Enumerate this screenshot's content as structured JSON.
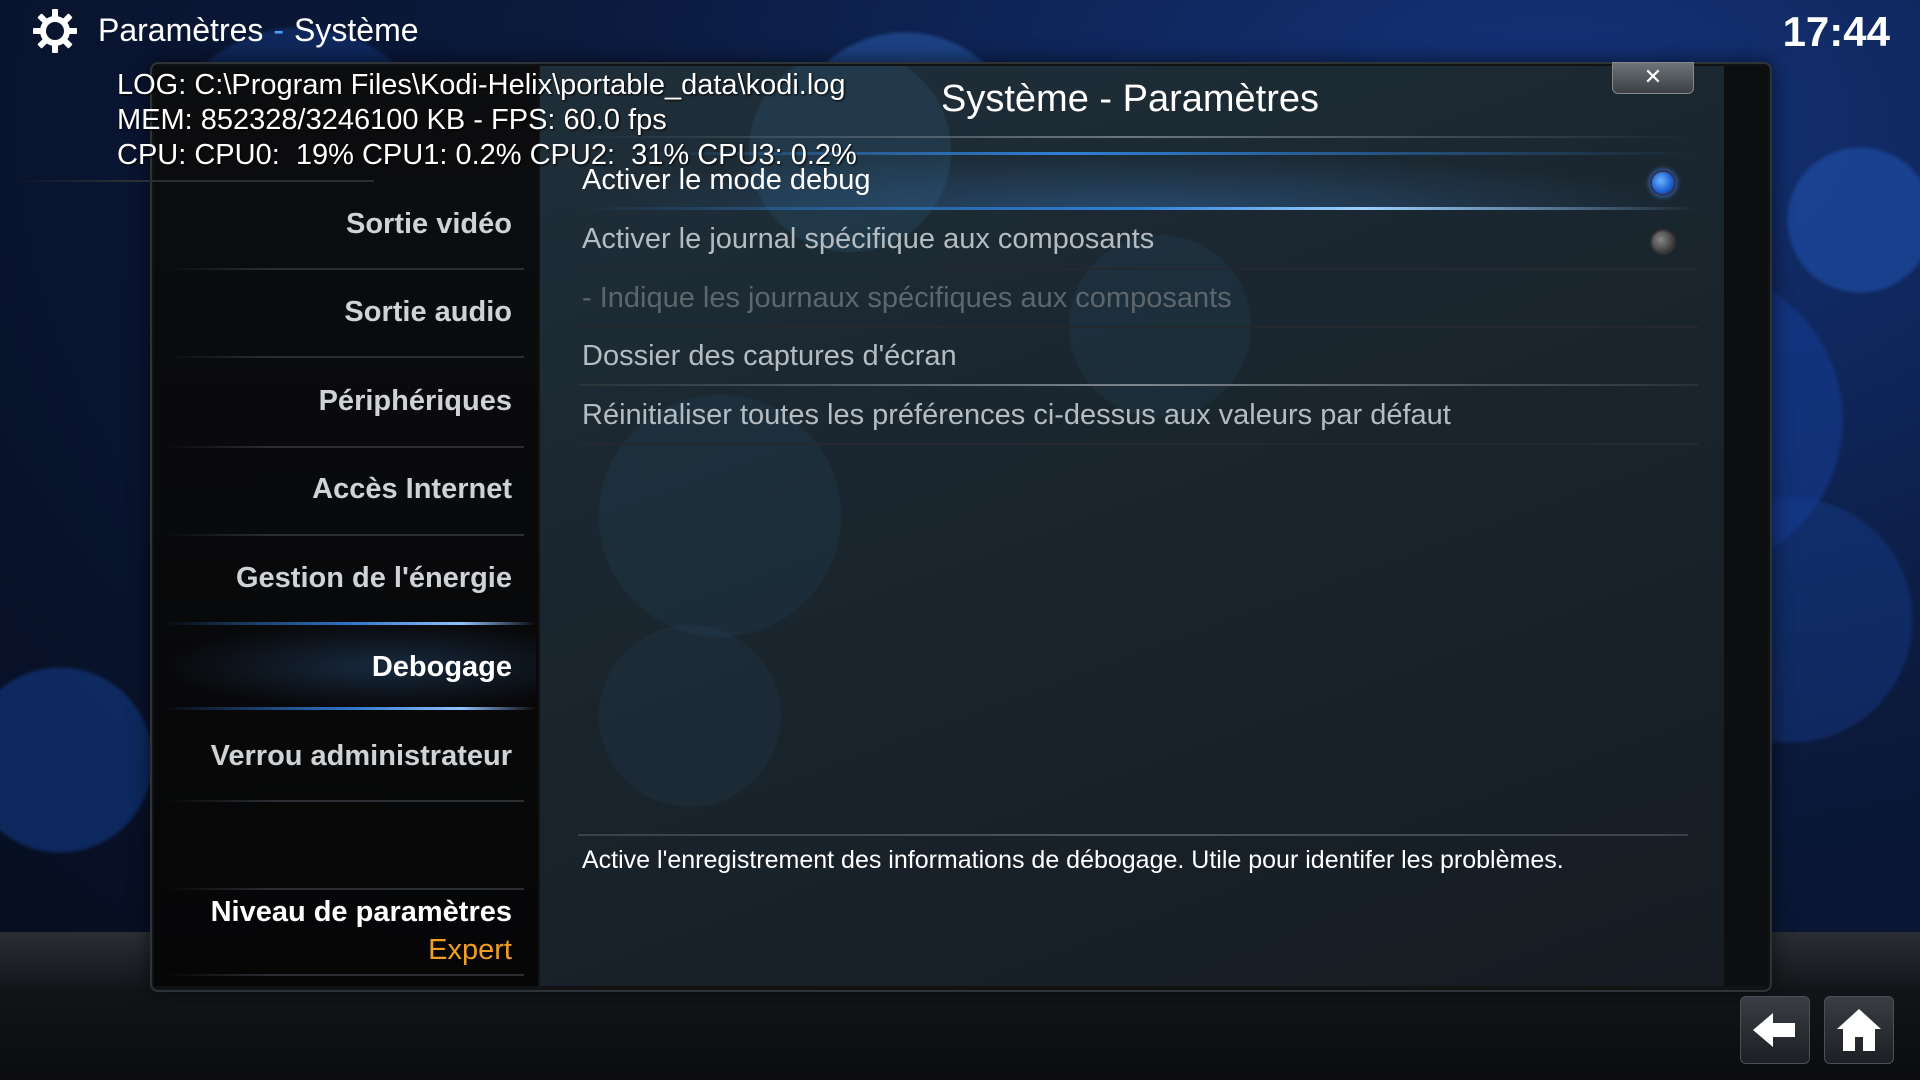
{
  "header": {
    "section": "Paramètres",
    "separator": "-",
    "subsection": "Système",
    "clock": "17:44",
    "icon": "gear-icon"
  },
  "debug_overlay": {
    "log": "LOG: C:\\Program Files\\Kodi-Helix\\portable_data\\kodi.log",
    "mem": "MEM: 852328/3246100 KB - FPS: 60.0 fps",
    "cpu": "CPU: CPU0:  19% CPU1: 0.2% CPU2:  31% CPU3: 0.2%"
  },
  "dialog": {
    "title": "Système - Paramètres",
    "close_label": "✕"
  },
  "sidebar": {
    "items": [
      {
        "label": "Sortie vidéo",
        "active": false
      },
      {
        "label": "Sortie audio",
        "active": false
      },
      {
        "label": "Périphériques",
        "active": false
      },
      {
        "label": "Accès Internet",
        "active": false
      },
      {
        "label": "Gestion de l'énergie",
        "active": false
      },
      {
        "label": "Debogage",
        "active": true
      },
      {
        "label": "Verrou administrateur",
        "active": false
      }
    ],
    "level_label": "Niveau de paramètres",
    "level_value": "Expert"
  },
  "settings": {
    "rows": [
      {
        "label": "Activer le mode debug",
        "state": "on",
        "focused": true
      },
      {
        "label": "Activer le journal spécifique aux composants",
        "state": "off",
        "focused": false
      },
      {
        "label": "- Indique les journaux spécifiques aux composants",
        "disabled": true
      },
      {
        "label": "Dossier des captures d'écran"
      },
      {
        "label": "Réinitialiser toutes les préférences ci-dessus aux valeurs par défaut"
      }
    ],
    "description": "Active l'enregistrement des informations de débogage. Utile pour identifer les problèmes."
  },
  "nav": {
    "back_icon": "back-arrow-icon",
    "home_icon": "home-icon"
  },
  "colors": {
    "accent": "#2f7fd6",
    "level_value": "#f0a020"
  }
}
